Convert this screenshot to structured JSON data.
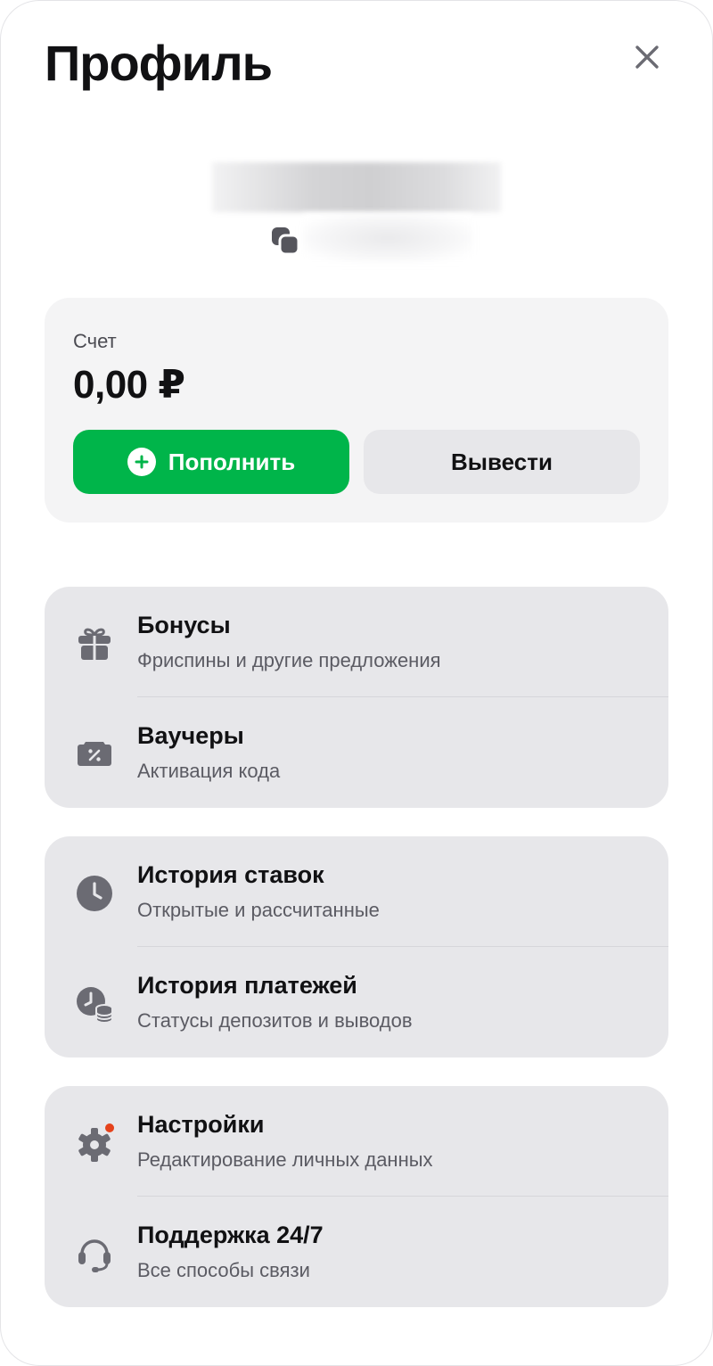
{
  "header": {
    "title": "Профиль",
    "close_icon": "close-icon"
  },
  "user": {
    "copy_icon": "copy-icon"
  },
  "balance": {
    "label": "Счет",
    "value": "0,00 ₽",
    "topup_label": "Пополнить",
    "withdraw_label": "Вывести",
    "accent": "#00b54a"
  },
  "groups": [
    {
      "items": [
        {
          "title": "Бонусы",
          "subtitle": "Фриспины и другие предложения",
          "icon": "gift-icon"
        },
        {
          "title": "Ваучеры",
          "subtitle": "Активация кода",
          "icon": "voucher-icon"
        }
      ]
    },
    {
      "items": [
        {
          "title": "История ставок",
          "subtitle": "Открытые и рассчитанные",
          "icon": "clock-icon"
        },
        {
          "title": "История платежей",
          "subtitle": "Статусы депозитов и выводов",
          "icon": "payment-history-icon"
        }
      ]
    },
    {
      "items": [
        {
          "title": "Настройки",
          "subtitle": "Редактирование личных данных",
          "icon": "gear-icon",
          "has_notification": true
        },
        {
          "title": "Поддержка 24/7",
          "subtitle": "Все способы связи",
          "icon": "headset-icon"
        }
      ]
    }
  ],
  "colors": {
    "icon": "#6b6b73",
    "notification": "#e5421b",
    "card_bg": "#e7e7ea"
  }
}
